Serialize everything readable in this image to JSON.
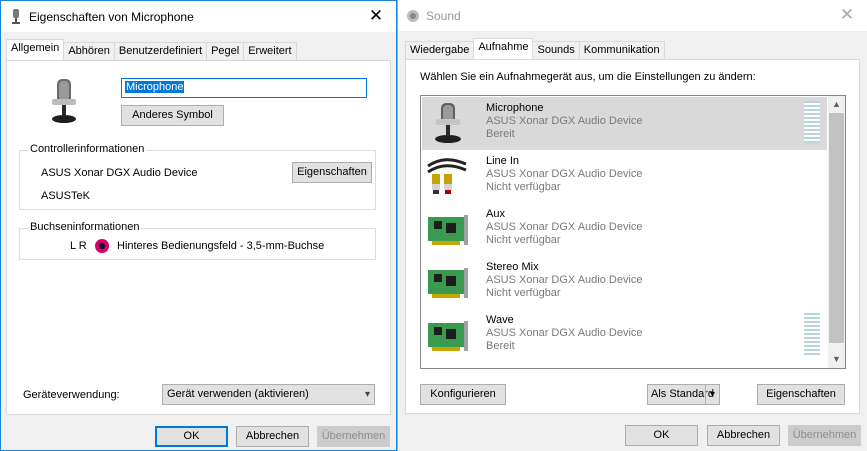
{
  "left_dialog": {
    "title": "Eigenschaften von Microphone",
    "tabs": [
      "Allgemein",
      "Abhören",
      "Benutzerdefiniert",
      "Pegel",
      "Erweitert"
    ],
    "active_tab": "Allgemein",
    "device_name_value": "Microphone",
    "change_icon_button": "Anderes Symbol",
    "controller_group": {
      "label": "Controllerinformationen",
      "device": "ASUS Xonar DGX Audio Device",
      "vendor": "ASUSTeK",
      "properties_button": "Eigenschaften"
    },
    "jack_group": {
      "label": "Buchseninformationen",
      "channels": "L R",
      "jack_text": "Hinteres Bedienungsfeld - 3,5-mm-Buchse",
      "jack_color": "#d6006e"
    },
    "usage_label": "Geräteverwendung:",
    "usage_value": "Gerät verwenden (aktivieren)",
    "buttons": {
      "ok": "OK",
      "cancel": "Abbrechen",
      "apply": "Übernehmen"
    }
  },
  "right_dialog": {
    "title": "Sound",
    "tabs": [
      "Wiedergabe",
      "Aufnahme",
      "Sounds",
      "Kommunikation"
    ],
    "active_tab": "Aufnahme",
    "instruction": "Wählen Sie ein Aufnahmegerät aus, um die Einstellungen zu ändern:",
    "devices": [
      {
        "name": "Microphone",
        "device": "ASUS Xonar DGX Audio Device",
        "status": "Bereit",
        "icon": "microphone-icon",
        "selected": true,
        "level_meter": true
      },
      {
        "name": "Line In",
        "device": "ASUS Xonar DGX Audio Device",
        "status": "Nicht verfügbar",
        "icon": "rca-cable-icon",
        "selected": false,
        "level_meter": false
      },
      {
        "name": "Aux",
        "device": "ASUS Xonar DGX Audio Device",
        "status": "Nicht verfügbar",
        "icon": "sound-card-icon",
        "selected": false,
        "level_meter": false
      },
      {
        "name": "Stereo Mix",
        "device": "ASUS Xonar DGX Audio Device",
        "status": "Nicht verfügbar",
        "icon": "sound-card-icon",
        "selected": false,
        "level_meter": false
      },
      {
        "name": "Wave",
        "device": "ASUS Xonar DGX Audio Device",
        "status": "Bereit",
        "icon": "sound-card-icon",
        "selected": false,
        "level_meter": true
      }
    ],
    "configure_button": "Konfigurieren",
    "set_default_button": "Als Standard",
    "properties_button": "Eigenschaften",
    "buttons": {
      "ok": "OK",
      "cancel": "Abbrechen",
      "apply": "Übernehmen"
    }
  }
}
